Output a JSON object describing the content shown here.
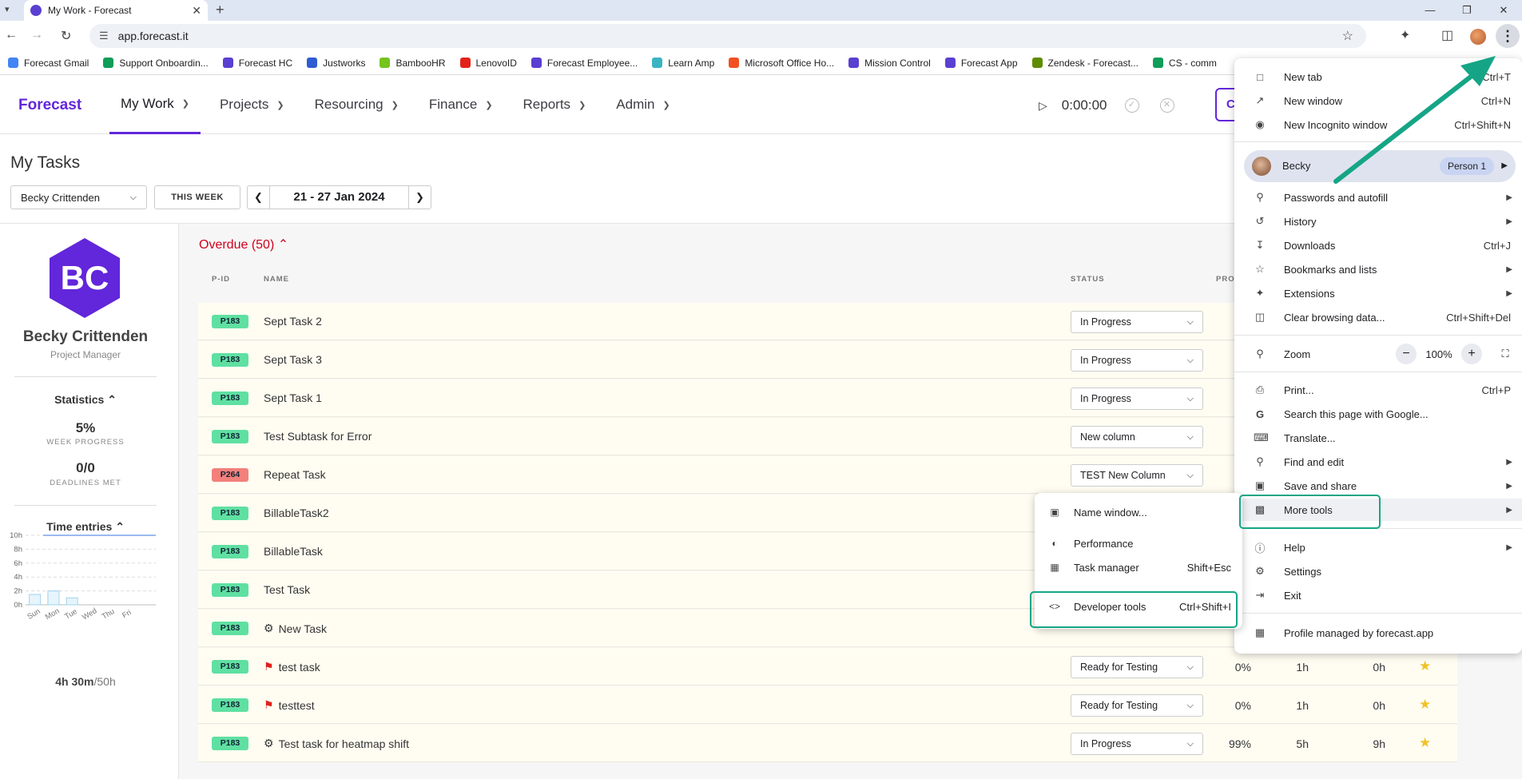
{
  "browser": {
    "tab_title": "My Work - Forecast",
    "url": "app.forecast.it",
    "bookmarks": [
      {
        "label": "Forecast Gmail",
        "color": "#4285f4"
      },
      {
        "label": "Support Onboardin...",
        "color": "#0f9d58"
      },
      {
        "label": "Forecast HC",
        "color": "#5a3fd1"
      },
      {
        "label": "Justworks",
        "color": "#2f5bd3"
      },
      {
        "label": "BambooHR",
        "color": "#73c41d"
      },
      {
        "label": "LenovoID",
        "color": "#e2231a"
      },
      {
        "label": "Forecast Employee...",
        "color": "#5a3fd1"
      },
      {
        "label": "Learn Amp",
        "color": "#3bb3c3"
      },
      {
        "label": "Microsoft Office Ho...",
        "color": "#f25022"
      },
      {
        "label": "Mission Control",
        "color": "#5a3fd1"
      },
      {
        "label": "Forecast App",
        "color": "#5a3fd1"
      },
      {
        "label": "Zendesk - Forecast...",
        "color": "#5e8c00"
      },
      {
        "label": "CS - comm",
        "color": "#0f9d58"
      }
    ]
  },
  "app": {
    "logo": "Forecast",
    "nav": [
      "My Work",
      "Projects",
      "Resourcing",
      "Finance",
      "Reports",
      "Admin"
    ],
    "timer": "0:00:00",
    "header_button": "C"
  },
  "page": {
    "title": "My Tasks",
    "person": "Becky Crittenden",
    "week_button": "THIS WEEK",
    "date_range": "21 - 27 Jan 2024"
  },
  "profile": {
    "initials": "BC",
    "name": "Becky Crittenden",
    "role": "Project Manager",
    "stats_heading": "Statistics",
    "week_progress": "5%",
    "week_progress_label": "WEEK PROGRESS",
    "deadlines": "0/0",
    "deadlines_label": "DEADLINES MET",
    "time_heading": "Time entries",
    "total_time": "4h 30m",
    "total_time_of": "/50h"
  },
  "chart_data": {
    "type": "bar",
    "categories": [
      "Sun",
      "Mon",
      "Tue",
      "Wed",
      "Thu",
      "Fri"
    ],
    "values": [
      1.5,
      2,
      1,
      0,
      0,
      0
    ],
    "yticks": [
      "10h",
      "8h",
      "6h",
      "4h",
      "2h",
      "0h"
    ],
    "ylim": [
      0,
      10
    ],
    "target_line": 10
  },
  "tasks": {
    "group_label": "Overdue (50)",
    "columns": {
      "pid": "P-ID",
      "name": "NAME",
      "status": "STATUS",
      "progress": "PRO"
    },
    "rows": [
      {
        "pid": "P183",
        "badge": "green",
        "icon": "",
        "name": "Sept Task 2",
        "status": "In Progress",
        "progress": "",
        "est": "",
        "rem": "",
        "star": false
      },
      {
        "pid": "P183",
        "badge": "green",
        "icon": "",
        "name": "Sept Task 3",
        "status": "In Progress",
        "progress": "",
        "est": "",
        "rem": "",
        "star": false
      },
      {
        "pid": "P183",
        "badge": "green",
        "icon": "",
        "name": "Sept Task 1",
        "status": "In Progress",
        "progress": "",
        "est": "",
        "rem": "",
        "star": false
      },
      {
        "pid": "P183",
        "badge": "green",
        "icon": "",
        "name": "Test Subtask for Error",
        "status": "New column",
        "progress": "",
        "est": "",
        "rem": "",
        "star": false
      },
      {
        "pid": "P264",
        "badge": "red",
        "icon": "",
        "name": "Repeat Task",
        "status": "TEST New Column",
        "progress": "",
        "est": "",
        "rem": "",
        "star": false
      },
      {
        "pid": "P183",
        "badge": "green",
        "icon": "",
        "name": "BillableTask2",
        "status": "",
        "progress": "",
        "est": "",
        "rem": "",
        "star": false
      },
      {
        "pid": "P183",
        "badge": "green",
        "icon": "",
        "name": "BillableTask",
        "status": "",
        "progress": "",
        "est": "",
        "rem": "",
        "star": false
      },
      {
        "pid": "P183",
        "badge": "green",
        "icon": "",
        "name": "Test Task",
        "status": "",
        "progress": "",
        "est": "",
        "rem": "",
        "star": false
      },
      {
        "pid": "P183",
        "badge": "green",
        "icon": "bug",
        "name": "New Task",
        "status": "",
        "progress": "",
        "est": "",
        "rem": "",
        "star": false
      },
      {
        "pid": "P183",
        "badge": "green",
        "icon": "flag",
        "name": "test task",
        "status": "Ready for Testing",
        "progress": "0%",
        "est": "1h",
        "rem": "0h",
        "star": true
      },
      {
        "pid": "P183",
        "badge": "green",
        "icon": "flag",
        "name": "testtest",
        "status": "Ready for Testing",
        "progress": "0%",
        "est": "1h",
        "rem": "0h",
        "star": true
      },
      {
        "pid": "P183",
        "badge": "green",
        "icon": "bug",
        "name": "Test task for heatmap shift",
        "status": "In Progress",
        "progress": "99%",
        "est": "5h",
        "rem": "9h",
        "star": true
      }
    ]
  },
  "chrome_menu": {
    "new_tab": "New tab",
    "new_tab_sc": "Ctrl+T",
    "new_window": "New window",
    "new_window_sc": "Ctrl+N",
    "incognito": "New Incognito window",
    "incognito_sc": "Ctrl+Shift+N",
    "profile_name": "Becky",
    "profile_badge": "Person 1",
    "passwords": "Passwords and autofill",
    "history": "History",
    "downloads": "Downloads",
    "downloads_sc": "Ctrl+J",
    "bookmarks": "Bookmarks and lists",
    "extensions": "Extensions",
    "clear": "Clear browsing data...",
    "clear_sc": "Ctrl+Shift+Del",
    "zoom": "Zoom",
    "zoom_value": "100%",
    "print": "Print...",
    "print_sc": "Ctrl+P",
    "search": "Search this page with Google...",
    "translate": "Translate...",
    "find": "Find and edit",
    "save": "Save and share",
    "more_tools": "More tools",
    "help": "Help",
    "settings": "Settings",
    "exit": "Exit",
    "managed": "Profile managed by forecast.app"
  },
  "more_tools_menu": {
    "name_window": "Name window...",
    "performance": "Performance",
    "task_manager": "Task manager",
    "task_manager_sc": "Shift+Esc",
    "devtools": "Developer tools",
    "devtools_sc": "Ctrl+Shift+I"
  },
  "colors": {
    "brand": "#6226db",
    "highlight": "#15a586",
    "overdue": "#d0021b"
  }
}
